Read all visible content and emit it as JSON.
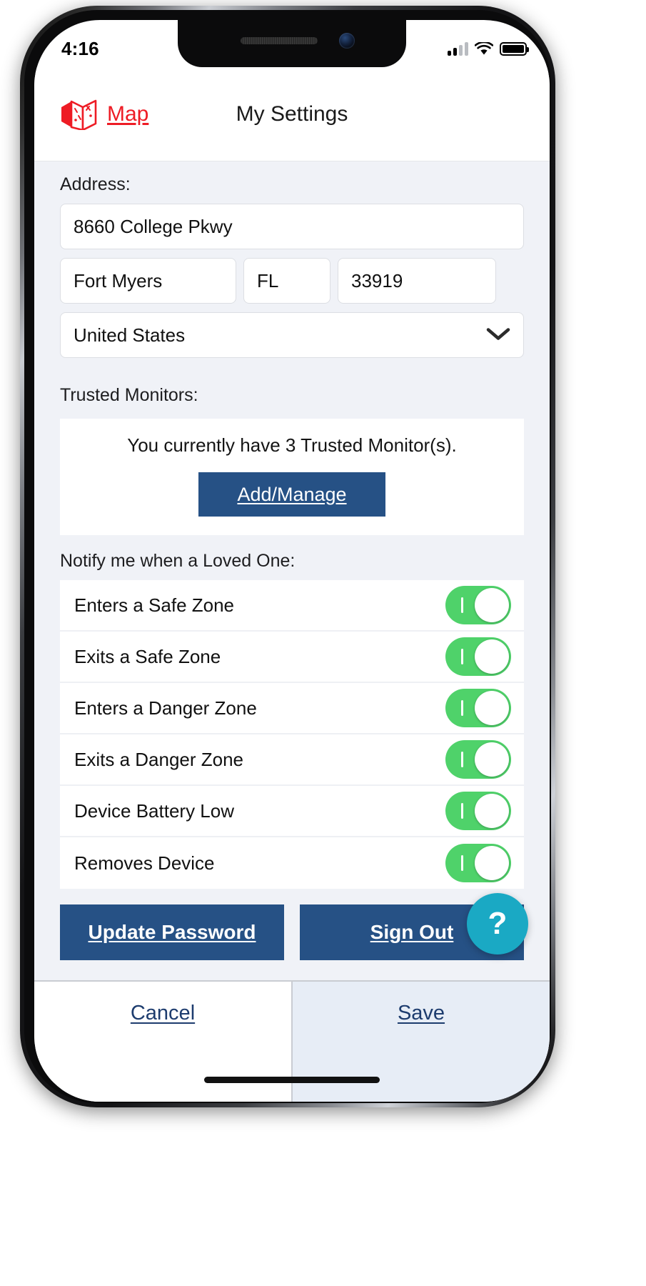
{
  "status_bar": {
    "time": "4:16",
    "signal_icon": "cellular-signal-icon",
    "wifi_icon": "wifi-icon",
    "battery_icon": "battery-full-icon"
  },
  "app_bar": {
    "back_label": "Map",
    "back_icon": "map-icon",
    "title": "My Settings",
    "accent_color": "#ee1c25"
  },
  "address": {
    "label": "Address:",
    "street": "8660 College Pkwy",
    "city": "Fort Myers",
    "state": "FL",
    "zip": "33919",
    "country": "United States",
    "country_chevron_icon": "chevron-down-icon"
  },
  "trusted_monitors": {
    "label": "Trusted Monitors:",
    "summary": "You currently have 3 Trusted Monitor(s).",
    "count": 3,
    "add_manage_label": "Add/Manage"
  },
  "notifications": {
    "label": "Notify me when a Loved One:",
    "items": [
      {
        "label": "Enters a Safe Zone",
        "enabled": true
      },
      {
        "label": "Exits a Safe Zone",
        "enabled": true
      },
      {
        "label": "Enters a Danger Zone",
        "enabled": true
      },
      {
        "label": "Exits a Danger Zone",
        "enabled": true
      },
      {
        "label": "Device Battery Low",
        "enabled": true
      },
      {
        "label": "Removes Device",
        "enabled": true
      }
    ]
  },
  "actions": {
    "update_password_label": "Update Password",
    "sign_out_label": "Sign Out",
    "primary_color": "#265185"
  },
  "help": {
    "label": "?",
    "icon": "question-mark-icon",
    "color": "#1aa9c4"
  },
  "bottom_bar": {
    "cancel_label": "Cancel",
    "save_label": "Save"
  }
}
